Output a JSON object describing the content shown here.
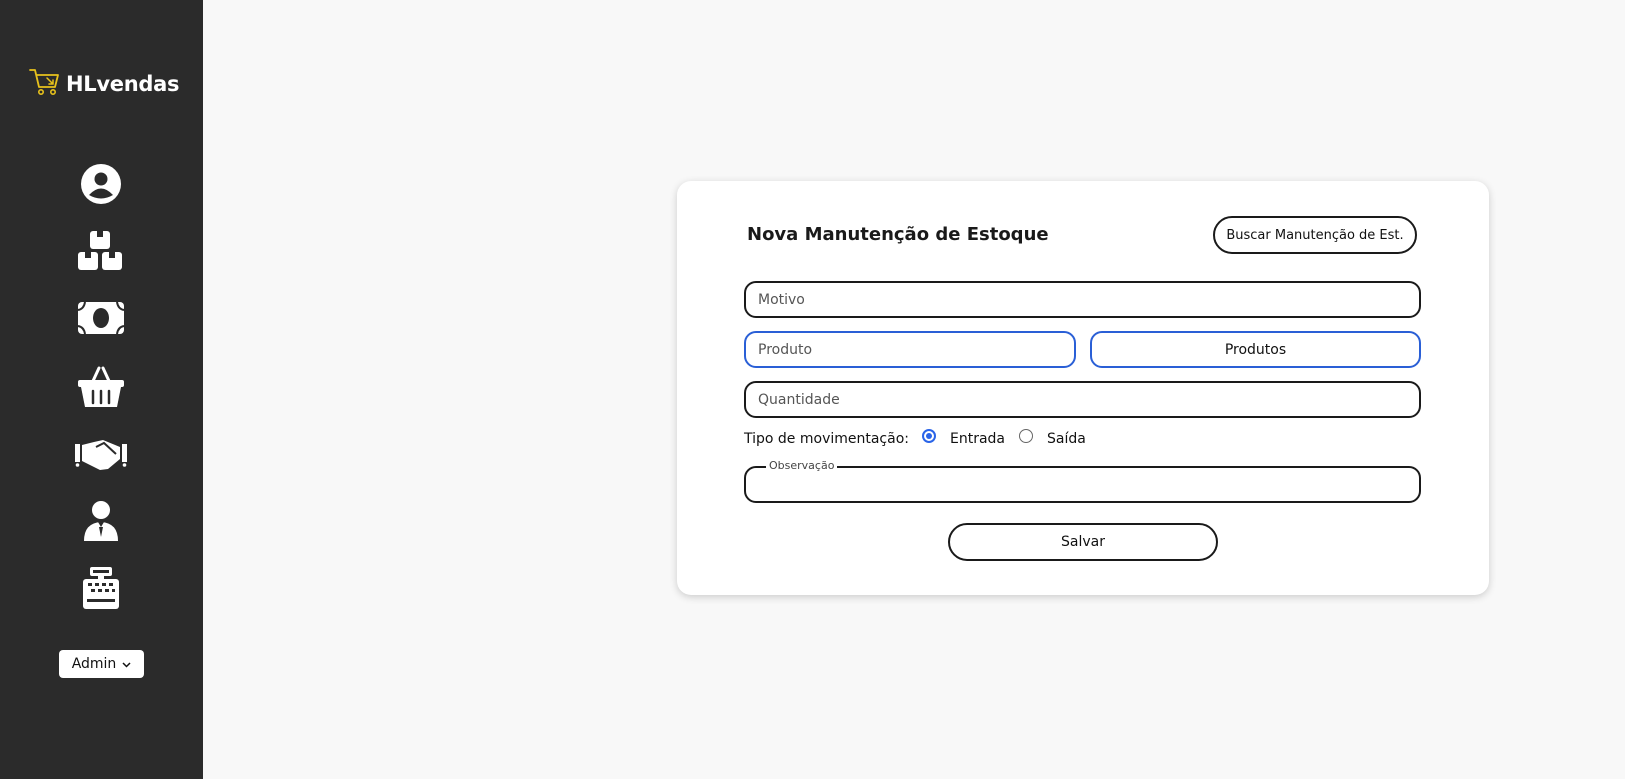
{
  "brand": {
    "name": "HLvendas",
    "icon": "shopping-cart-icon",
    "accent_color": "#e8c21c"
  },
  "sidebar": {
    "background": "#2b2b2b",
    "items": [
      {
        "icon": "user-circle-icon"
      },
      {
        "icon": "boxes-icon"
      },
      {
        "icon": "money-bill-icon"
      },
      {
        "icon": "shopping-basket-icon"
      },
      {
        "icon": "handshake-icon"
      },
      {
        "icon": "employee-icon"
      },
      {
        "icon": "cash-register-icon"
      }
    ],
    "user_menu": {
      "label": "Admin",
      "icon": "chevron-down-icon"
    }
  },
  "form": {
    "title": "Nova Manutenção de Estoque",
    "search_button": "Buscar Manutenção de Est.",
    "motivo_placeholder": "Motivo",
    "produto_placeholder": "Produto",
    "produtos_button": "Produtos",
    "quantidade_placeholder": "Quantidade",
    "tipo_label": "Tipo de movimentação:",
    "tipo_options": [
      {
        "label": "Entrada",
        "checked": true
      },
      {
        "label": "Saída",
        "checked": false
      }
    ],
    "observacao_label": "Observação",
    "save_button": "Salvar"
  },
  "colors": {
    "focus_blue": "#2a5fd6",
    "radio_blue": "#2a64e8"
  }
}
